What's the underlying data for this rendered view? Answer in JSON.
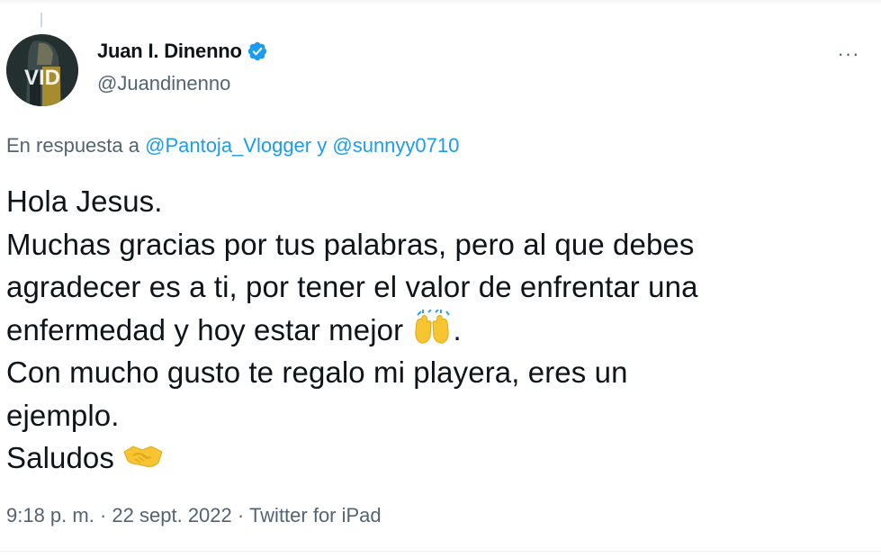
{
  "author": {
    "display_name": "Juan I. Dinenno",
    "handle": "@Juandinenno",
    "verified": true,
    "avatar_text": "VID"
  },
  "more_menu": {
    "label": "···"
  },
  "reply_context": {
    "prefix": "En respuesta a",
    "mention_1": "@Pantoja_Vlogger",
    "connector": "y",
    "mention_2": "@sunnyy0710"
  },
  "tweet": {
    "lines": [
      "Hola Jesus.",
      "Muchas gracias por tus palabras, pero al que debes",
      "agradecer es a ti, por tener el valor de enfrentar una",
      "enfermedad y hoy estar mejor",
      ".",
      "Con mucho gusto te regalo mi playera, eres un",
      "ejemplo.",
      "Saludos"
    ],
    "emojis": [
      "raising-hands-icon",
      "handshake-icon"
    ]
  },
  "meta": {
    "time": "9:18 p. m.",
    "separator": "·",
    "date": "22 sept. 2022",
    "source": "Twitter for iPad"
  },
  "colors": {
    "text": "#0f1419",
    "secondary": "#536471",
    "link": "#1d9bf0",
    "verified": "#1d9bf0"
  }
}
